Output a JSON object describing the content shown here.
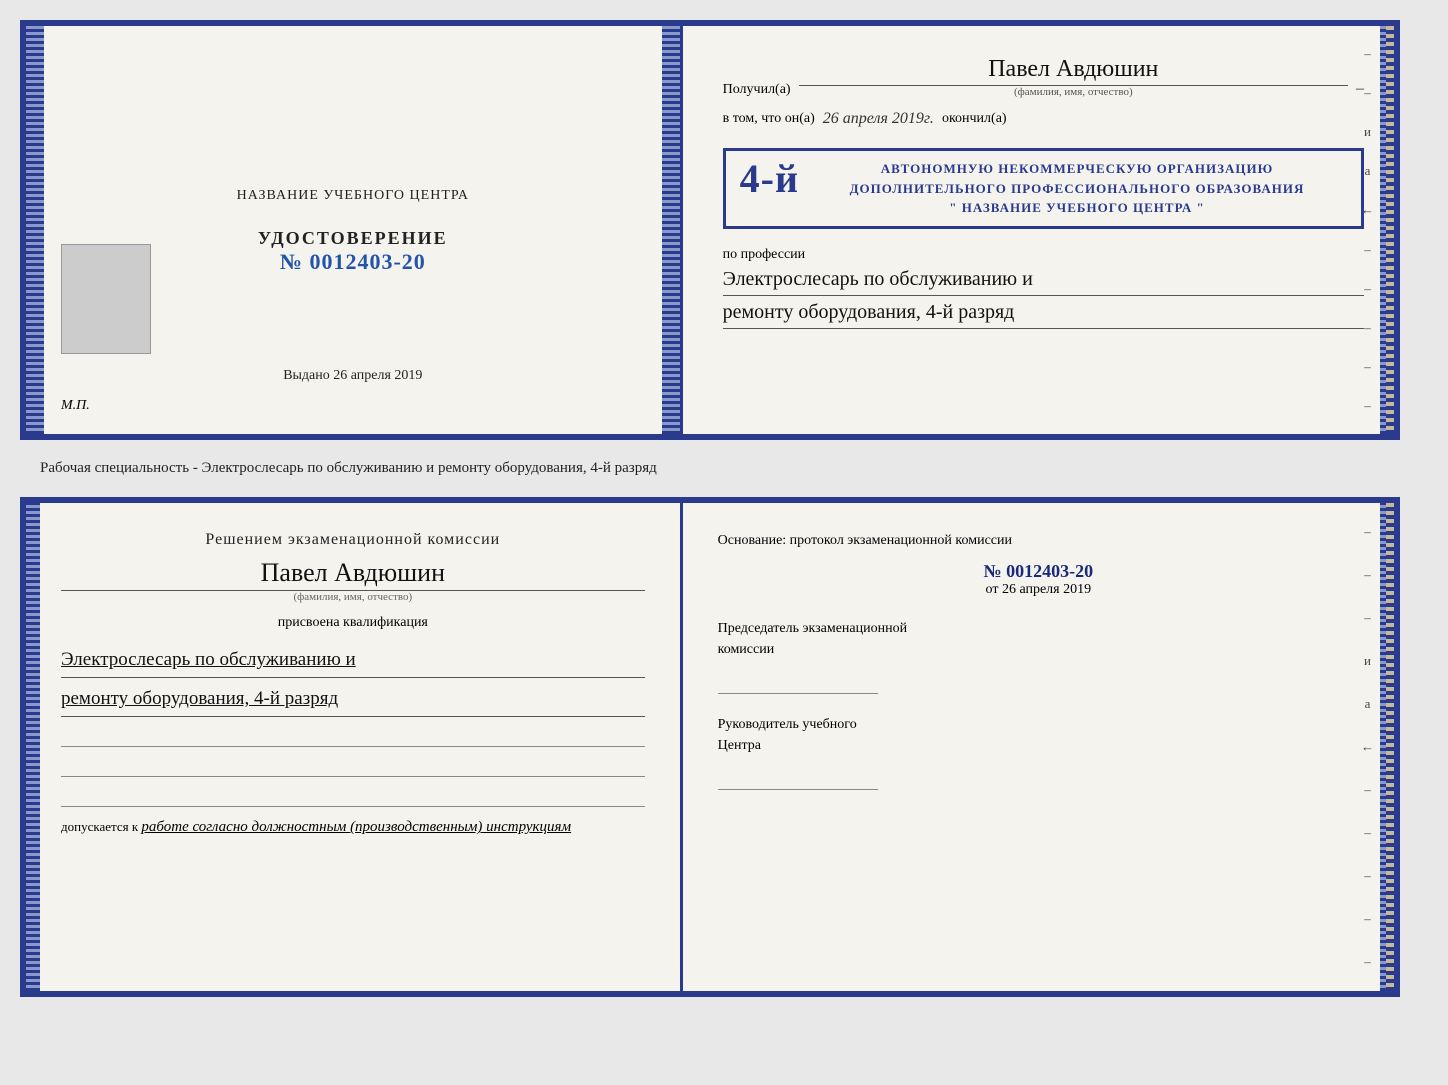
{
  "top_doc": {
    "left": {
      "center_name": "НАЗВАНИЕ УЧЕБНОГО ЦЕНТРА",
      "udostoverenie": "УДОСТОВЕРЕНИЕ",
      "number": "№ 0012403-20",
      "issued_label": "Выдано",
      "issued_date": "26 апреля 2019",
      "mp_label": "М.П."
    },
    "right": {
      "recipient_label": "Получил(а)",
      "recipient_name": "Павел Авдюшин",
      "fio_label": "(фамилия, имя, отчество)",
      "in_that": "в том, что он(а)",
      "date_handwritten": "26 апреля 2019г.",
      "finished_label": "окончил(а)",
      "stamp_line1": "4-й",
      "stamp_line2": "АВТОНОМНУЮ НЕКОММЕРЧЕСКУЮ ОРГАНИЗАЦИЮ",
      "stamp_line3": "ДОПОЛНИТЕЛЬНОГО ПРОФЕССИОНАЛЬНОГО ОБРАЗОВАНИЯ",
      "stamp_line4": "\" НАЗВАНИЕ УЧЕБНОГО ЦЕНТРА \"",
      "profession_label": "по профессии",
      "profession_text1": "Электрослесарь по обслуживанию и",
      "profession_text2": "ремонту оборудования, 4-й разряд"
    }
  },
  "middle_text": "Рабочая специальность - Электрослесарь по обслуживанию и ремонту оборудования, 4-й\nразряд",
  "bottom_doc": {
    "left": {
      "decision_label": "Решением экзаменационной комиссии",
      "person_name": "Павел Авдюшин",
      "fio_label": "(фамилия, имя, отчество)",
      "assigned_label": "присвоена квалификация",
      "qualification_line1": "Электрослесарь по обслуживанию и",
      "qualification_line2": "ремонту оборудования, 4-й разряд",
      "admitted_label": "допускается к",
      "admitted_text": "работе согласно должностным (производственным) инструкциям"
    },
    "right": {
      "basis_label": "Основание: протокол экзаменационной комиссии",
      "protocol_number": "№  0012403-20",
      "date_prefix": "от",
      "protocol_date": "26 апреля 2019",
      "chairman_label": "Председатель экзаменационной\nкомиссии",
      "head_label": "Руководитель учебного\nЦентра"
    }
  },
  "side_dashes": [
    "-",
    "-",
    "-",
    "-",
    "и",
    "а",
    "←",
    "-",
    "-",
    "-",
    "-",
    "-"
  ]
}
